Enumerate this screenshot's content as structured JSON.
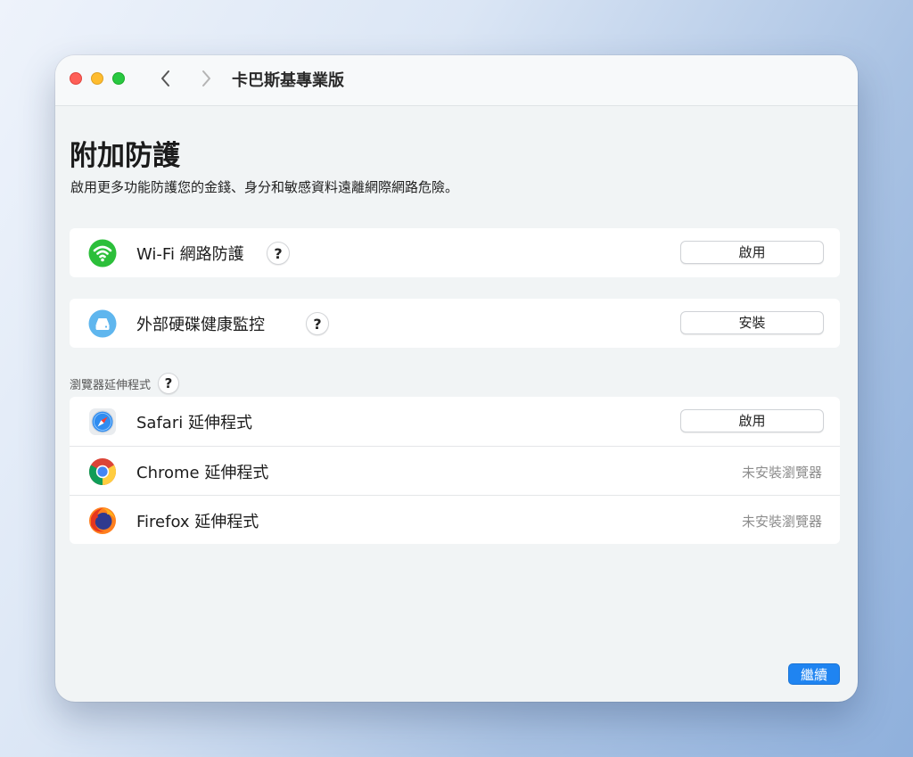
{
  "window": {
    "title": "卡巴斯基專業版"
  },
  "page": {
    "title": "附加防護",
    "subtitle": "啟用更多功能防護您的金錢、身分和敏感資料遠離網際網路危險。"
  },
  "features": [
    {
      "label": "Wi-Fi 網路防護",
      "help": "?",
      "action": "啟用",
      "icon": "wifi-icon"
    },
    {
      "label": "外部硬碟健康監控",
      "help": "?",
      "action": "安裝",
      "icon": "hard-drive-icon"
    }
  ],
  "browser_section": {
    "label": "瀏覽器延伸程式",
    "help": "?",
    "items": [
      {
        "label": "Safari 延伸程式",
        "action": "啟用",
        "icon": "safari-icon"
      },
      {
        "label": "Chrome 延伸程式",
        "status": "未安裝瀏覽器",
        "icon": "chrome-icon"
      },
      {
        "label": "Firefox 延伸程式",
        "status": "未安裝瀏覽器",
        "icon": "firefox-icon"
      }
    ]
  },
  "footer": {
    "continue_label": "繼續"
  },
  "colors": {
    "accent": "#1f84f1",
    "wifi_green": "#2cbf3a",
    "drive_blue": "#5fb6ee"
  }
}
